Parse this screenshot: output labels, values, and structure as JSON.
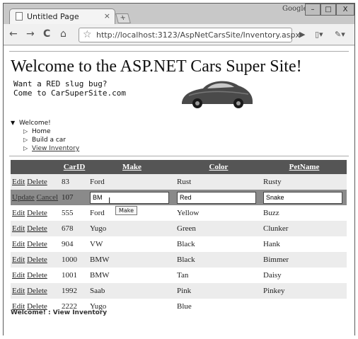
{
  "browser": {
    "tab_title": "Untitled Page",
    "tab_close": "×",
    "new_tab": "+",
    "brand": "Google",
    "window_buttons": [
      "–",
      "□",
      "X"
    ],
    "nav": {
      "back": "←",
      "forward": "→",
      "reload": "C",
      "home": "⌂"
    },
    "url": "http://localhost:3123/AspNetCarsSite/Inventory.aspx",
    "star": "☆",
    "page_menu": "▶",
    "doc_menu": "▯▾",
    "wrench_menu": "✎▾"
  },
  "page": {
    "title": "Welcome to the ASP.NET Cars Super Site!",
    "promo_line1": "Want a RED slug bug?",
    "promo_line2": "Come to CarSuperSite.com",
    "tree": {
      "root": "Welcome!",
      "items": [
        "Home",
        "Build a car",
        "View Inventory"
      ]
    },
    "grid": {
      "headers": [
        "CarID",
        "Make",
        "Color",
        "PetName"
      ],
      "edit_link": "Edit",
      "delete_link": "Delete",
      "update_link": "Update",
      "cancel_link": "Cancel",
      "rows": [
        {
          "id": "83",
          "make": "Ford",
          "color": "Rust",
          "pet": "Rusty"
        },
        {
          "id": "107",
          "make": "BM",
          "color": "Red",
          "pet": "Snake"
        },
        {
          "id": "555",
          "make": "Ford",
          "color": "Yellow",
          "pet": "Buzz"
        },
        {
          "id": "678",
          "make": "Yugo",
          "color": "Green",
          "pet": "Clunker"
        },
        {
          "id": "904",
          "make": "VW",
          "color": "Black",
          "pet": "Hank"
        },
        {
          "id": "1000",
          "make": "BMW",
          "color": "Black",
          "pet": "Bimmer"
        },
        {
          "id": "1001",
          "make": "BMW",
          "color": "Tan",
          "pet": "Daisy"
        },
        {
          "id": "1992",
          "make": "Saab",
          "color": "Pink",
          "pet": "Pinkey"
        },
        {
          "id": "2222",
          "make": "Yugo",
          "color": "Blue",
          "pet": ""
        }
      ]
    },
    "tooltip": "Make",
    "breadcrumb": "Welcome! : View Inventory"
  }
}
